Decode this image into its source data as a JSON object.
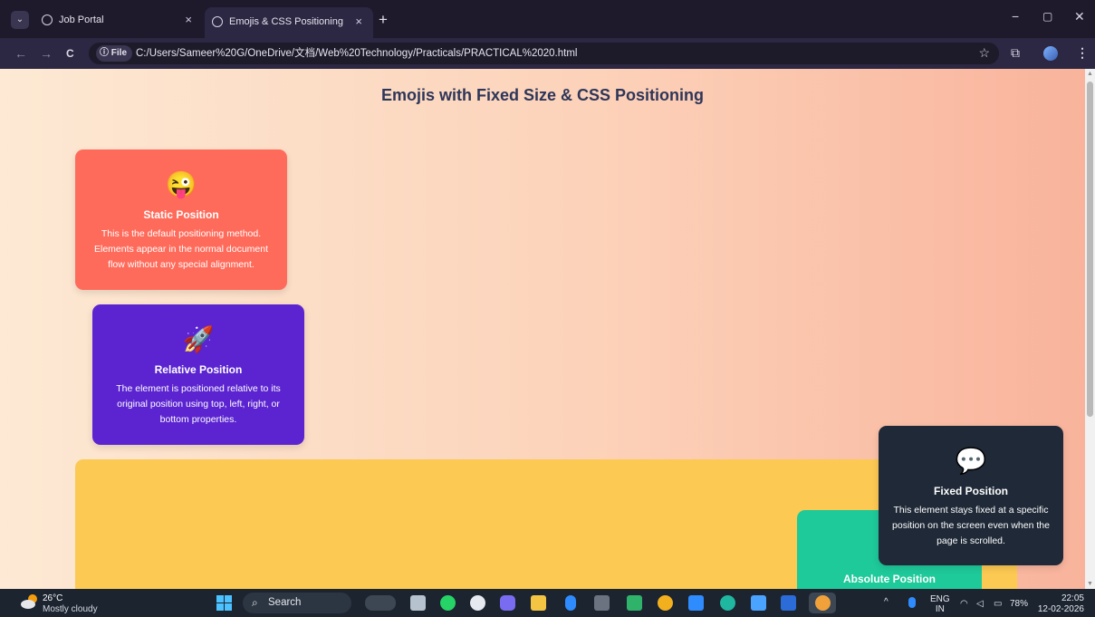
{
  "browser": {
    "tabs": [
      {
        "label": "Job Portal",
        "active": false
      },
      {
        "label": "Emojis & CSS Positioning",
        "active": true
      }
    ],
    "new_tab": "+",
    "close_glyph": "×",
    "nav": {
      "back": "←",
      "forward": "→",
      "reload": "C"
    },
    "chip_label": "File",
    "url": "C:/Users/Sameer%20G/OneDrive/文档/Web%20Technology/Practicals/PRACTICAL%2020.html",
    "window_controls": {
      "minimize": "−",
      "restore": "▢",
      "close": "✕"
    }
  },
  "page": {
    "heading": "Emojis with Fixed Size & CSS Positioning",
    "cards": {
      "static": {
        "emoji": "😜",
        "title": "Static Position",
        "text": "This is the default positioning method. Elements appear in the normal document flow without any special alignment.",
        "color": "#ff6b5b"
      },
      "relative": {
        "emoji": "🚀",
        "title": "Relative Position",
        "text": "The element is positioned relative to its original position using top, left, right, or bottom properties.",
        "color": "#5b24d0"
      },
      "absolute": {
        "title": "Absolute Position",
        "color": "#1ec99a"
      },
      "fixed": {
        "emoji": "💬",
        "title": "Fixed Position",
        "text": "This element stays fixed at a specific position on the screen even when the page is scrolled.",
        "color": "#1f2937"
      }
    },
    "container_color": "#fcc952"
  },
  "taskbar": {
    "weather": {
      "temp": "26°C",
      "condition": "Mostly cloudy"
    },
    "search_label": "Search",
    "tray": {
      "lang": "ENG",
      "region": "IN",
      "battery": "78%",
      "time": "22:05",
      "date": "12-02-2026"
    },
    "apps": [
      {
        "icon": "task-view-icon",
        "color": "#b7c2cf"
      },
      {
        "icon": "whatsapp-icon",
        "color": "#25d366"
      },
      {
        "icon": "chatgpt-icon",
        "color": "#e6e9ef"
      },
      {
        "icon": "copilot-icon",
        "color": "#7a6cf0"
      },
      {
        "icon": "file-explorer-icon",
        "color": "#f4c542"
      },
      {
        "icon": "bluetooth-icon",
        "color": "#2f8cff"
      },
      {
        "icon": "terminal-icon",
        "color": "#6b7280"
      },
      {
        "icon": "app-icon",
        "color": "#2fb36b"
      },
      {
        "icon": "chrome-icon",
        "color": "#f2b01e"
      },
      {
        "icon": "vscode-icon",
        "color": "#2f8cff"
      },
      {
        "icon": "edge-icon",
        "color": "#1fb7a0"
      },
      {
        "icon": "app-a-icon",
        "color": "#4aa3ff"
      },
      {
        "icon": "word-icon",
        "color": "#2b6cd8"
      },
      {
        "icon": "chrome-dev-icon",
        "color": "#f0a13a"
      }
    ]
  }
}
